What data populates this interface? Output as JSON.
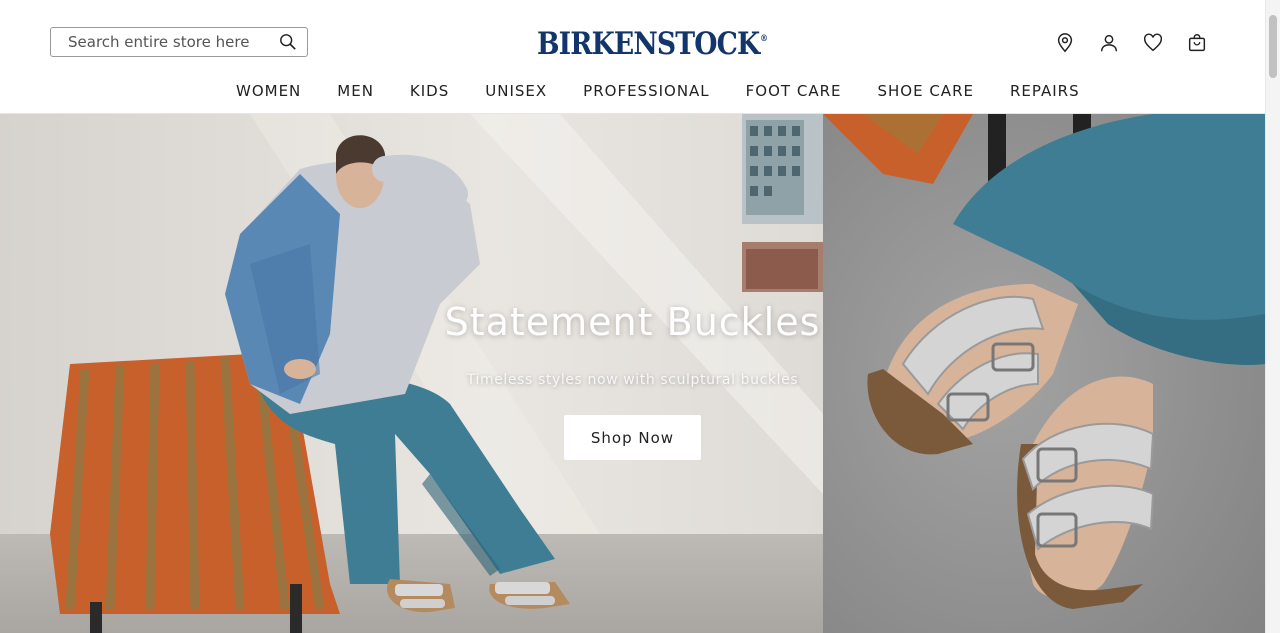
{
  "header": {
    "search_placeholder": "Search entire store here",
    "brand": "BIRKENSTOCK",
    "brand_mark": "®",
    "icons": [
      "location-icon",
      "account-icon",
      "wishlist-icon",
      "cart-icon"
    ]
  },
  "nav": [
    "WOMEN",
    "MEN",
    "KIDS",
    "UNISEX",
    "PROFESSIONAL",
    "FOOT CARE",
    "SHOE CARE",
    "REPAIRS"
  ],
  "hero": {
    "title": "Statement Buckles",
    "subtitle": "Timeless styles now with sculptural buckles",
    "cta": "Shop Now"
  },
  "colors": {
    "brand": "#12356b",
    "accent_orange": "#c8602c",
    "denim": "#3f7d94"
  }
}
